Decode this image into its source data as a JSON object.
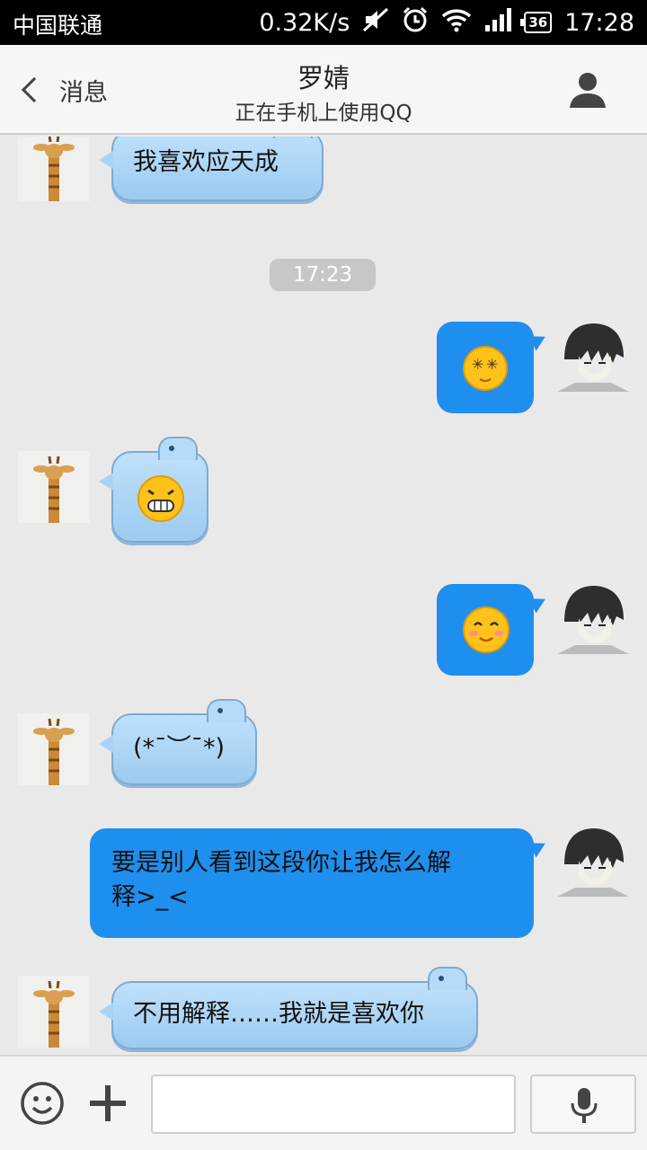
{
  "status_bar": {
    "carrier": "中国联通",
    "net_speed": "0.32K/s",
    "battery": "36",
    "time": "17:28",
    "icons": [
      "mute-icon",
      "alarm-icon",
      "wifi-icon",
      "signal-icon",
      "battery-icon"
    ]
  },
  "header": {
    "back_label": "消息",
    "title": "罗婧",
    "subtitle": "正在手机上使用QQ",
    "profile_icon": "person-icon"
  },
  "chat": {
    "messages": [
      {
        "side": "in",
        "type": "text",
        "text": "我喜欢应天成"
      },
      {
        "type": "time",
        "text": "17:23"
      },
      {
        "side": "out",
        "type": "emoji",
        "emoji": "dizzy-face-emoji"
      },
      {
        "side": "in",
        "type": "emoji",
        "emoji": "grin-face-emoji"
      },
      {
        "side": "out",
        "type": "emoji",
        "emoji": "shy-smile-emoji"
      },
      {
        "side": "in",
        "type": "text",
        "text": "(*ˉ︶ˉ*)"
      },
      {
        "side": "out",
        "type": "text",
        "text": "要是别人看到这段你让我怎么解\n释>_<"
      },
      {
        "side": "in",
        "type": "text",
        "text": "不用解释……我就是喜欢你"
      }
    ]
  },
  "input_bar": {
    "placeholder": "",
    "value": "",
    "emoji_icon": "smiley-icon",
    "plus_icon": "plus-icon",
    "mic_icon": "microphone-icon"
  },
  "colors": {
    "status_bar": "#000000",
    "header_bg": "#f6f6f6",
    "chat_bg": "#e9e9e9",
    "incoming_bubble": "#aed6f6",
    "outgoing_bubble": "#1e8fee"
  }
}
